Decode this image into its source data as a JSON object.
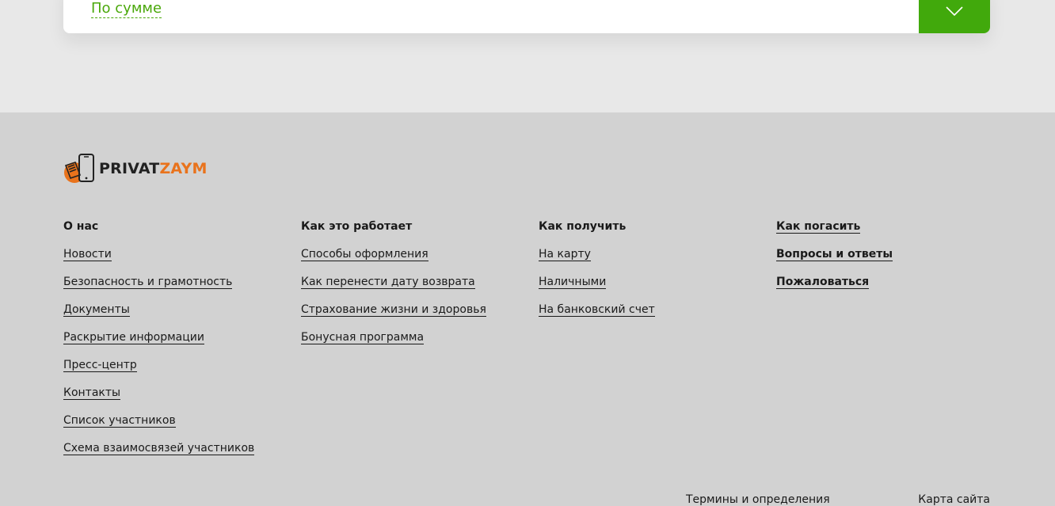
{
  "filter": {
    "sort_label": "По сумме",
    "toggle_icon": "chevron-down-icon",
    "accent_color": "#41a90c"
  },
  "footer": {
    "logo": {
      "part1": "PRIVAT",
      "part2": "ZAYM"
    },
    "columns": [
      {
        "items": [
          {
            "label": "О нас"
          },
          {
            "label": "Новости"
          },
          {
            "label": "Безопасность и грамотность"
          },
          {
            "label": "Документы"
          },
          {
            "label": "Раскрытие информации"
          },
          {
            "label": "Пресс-центр"
          },
          {
            "label": "Контакты"
          },
          {
            "label": "Список участников"
          },
          {
            "label": "Схема взаимосвязей участников"
          }
        ]
      },
      {
        "items": [
          {
            "label": "Как это работает"
          },
          {
            "label": "Способы оформления"
          },
          {
            "label": "Как перенести дату возврата"
          },
          {
            "label": "Страхование жизни и здоровья"
          },
          {
            "label": "Бонусная программа"
          }
        ]
      },
      {
        "items": [
          {
            "label": "Как получить"
          },
          {
            "label": "На карту"
          },
          {
            "label": "Наличными"
          },
          {
            "label": "На банковский счет"
          }
        ]
      },
      {
        "items": [
          {
            "label": "Как погасить"
          },
          {
            "label": "Вопросы и ответы"
          },
          {
            "label": "Пожаловаться"
          }
        ]
      }
    ],
    "bottom_links": {
      "terms": "Термины и определения",
      "sitemap": "Карта сайта"
    }
  }
}
